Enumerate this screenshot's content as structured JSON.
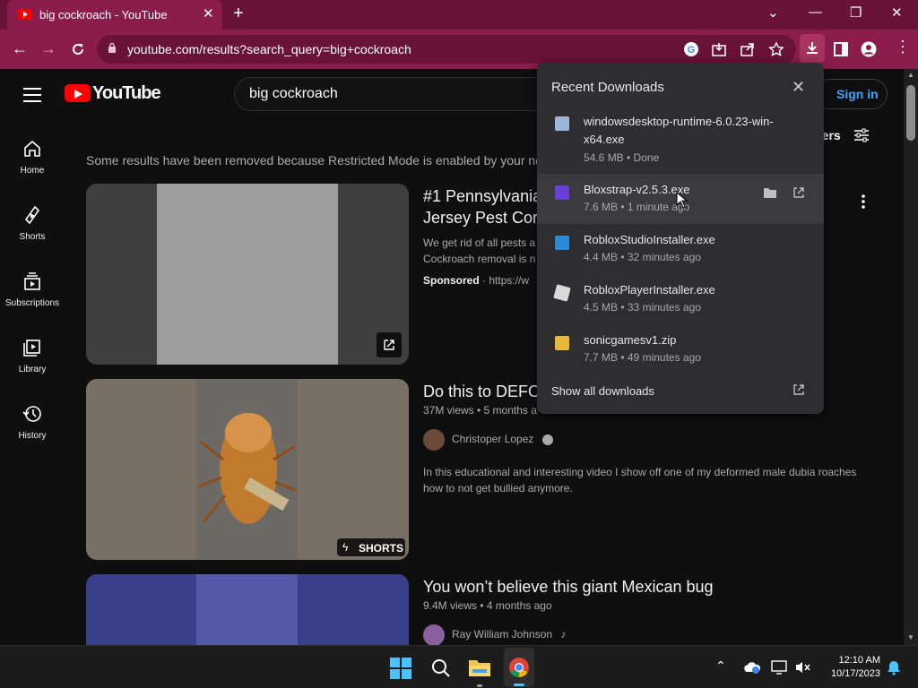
{
  "browser": {
    "tab_title": "big cockroach - YouTube",
    "url": "youtube.com/results?search_query=big+cockroach",
    "new_tab": "+",
    "tab_close": "✕"
  },
  "youtube": {
    "logo_text": "YouTube",
    "search_value": "big cockroach",
    "sign_in": "Sign in",
    "filters_label": "ters",
    "sidebar": [
      {
        "label": "Home"
      },
      {
        "label": "Shorts"
      },
      {
        "label": "Subscriptions"
      },
      {
        "label": "Library"
      },
      {
        "label": "History"
      }
    ],
    "restricted_notice": "Some results have been removed because Restricted Mode is enabled by your ne",
    "results": [
      {
        "title_l1": "#1 Pennsylvania",
        "title_l2": "Jersey Pest Cor",
        "desc_l1": "We get rid of all pests a",
        "desc_l2": "Cockroach removal is n",
        "sponsored": "Sponsored",
        "sponsored_url": "· https://w"
      },
      {
        "title": "Do this to DEFO",
        "meta": "37M views • 5 months a",
        "channel": "Christoper Lopez",
        "desc_l1": "In this educational and interesting video I show off one of my deformed male dubia roaches",
        "desc_l2": "how to not get bullied anymore.",
        "badge": "SHORTS"
      },
      {
        "title": "You won’t believe this giant Mexican bug",
        "meta": "9.4M views • 4 months ago",
        "channel": "Ray William Johnson"
      }
    ]
  },
  "downloads": {
    "title": "Recent Downloads",
    "show_all": "Show all downloads",
    "items": [
      {
        "name_l1": "windowsdesktop-runtime-6.0.23-win-",
        "name_l2": "x64.exe",
        "status": "54.6 MB • Done"
      },
      {
        "name_l1": "Bloxstrap-v2.5.3.exe",
        "status": "7.6 MB • 1 minute ago"
      },
      {
        "name_l1": "RobloxStudioInstaller.exe",
        "status": "4.4 MB • 32 minutes ago"
      },
      {
        "name_l1": "RobloxPlayerInstaller.exe",
        "status": "4.5 MB • 33 minutes ago"
      },
      {
        "name_l1": "sonicgamesv1.zip",
        "status": "7.7 MB • 49 minutes ago"
      }
    ]
  },
  "taskbar": {
    "time": "12:10 AM",
    "date": "10/17/2023"
  },
  "colors": {
    "tabbar": "#69133b",
    "toolbar": "#8b1d4e",
    "youtube_red": "#ff0000",
    "link_blue": "#3ea6ff"
  }
}
